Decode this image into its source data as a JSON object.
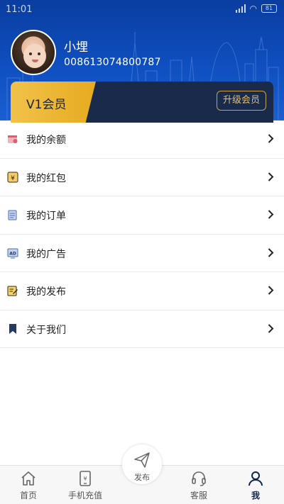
{
  "status_bar": {
    "time": "11:01",
    "battery": "81",
    "icons": [
      "signal-icon",
      "wifi-icon",
      "battery-icon"
    ]
  },
  "profile": {
    "name": "小埋",
    "phone": "008613074800787"
  },
  "vip": {
    "level": "V1会员",
    "upgrade_label": "升级会员"
  },
  "menu": [
    {
      "label": "我的余额",
      "icon": "wallet-icon",
      "color": "#e85a6a"
    },
    {
      "label": "我的红包",
      "icon": "red-envelope-icon",
      "color": "#d9a43b"
    },
    {
      "label": "我的订单",
      "icon": "order-icon",
      "color": "#4a6fb5"
    },
    {
      "label": "我的广告",
      "icon": "ad-icon",
      "color": "#4a6fb5"
    },
    {
      "label": "我的发布",
      "icon": "publish-edit-icon",
      "color": "#e7b52b"
    },
    {
      "label": "关于我们",
      "icon": "bookmark-icon",
      "color": "#253a5e"
    }
  ],
  "tab_bar": {
    "tabs": [
      {
        "label": "首页",
        "icon": "home-icon"
      },
      {
        "label": "手机充值",
        "icon": "phone-recharge-icon"
      },
      {
        "label": "客服",
        "icon": "customer-service-icon"
      },
      {
        "label": "我",
        "icon": "profile-icon"
      }
    ],
    "publish_label": "发布",
    "active": "我"
  },
  "colors": {
    "header_bg": "#0f4fbf",
    "vip_gold": "#f1c24a",
    "vip_dark": "#1a2a4a",
    "active_tab": "#0d2550"
  }
}
